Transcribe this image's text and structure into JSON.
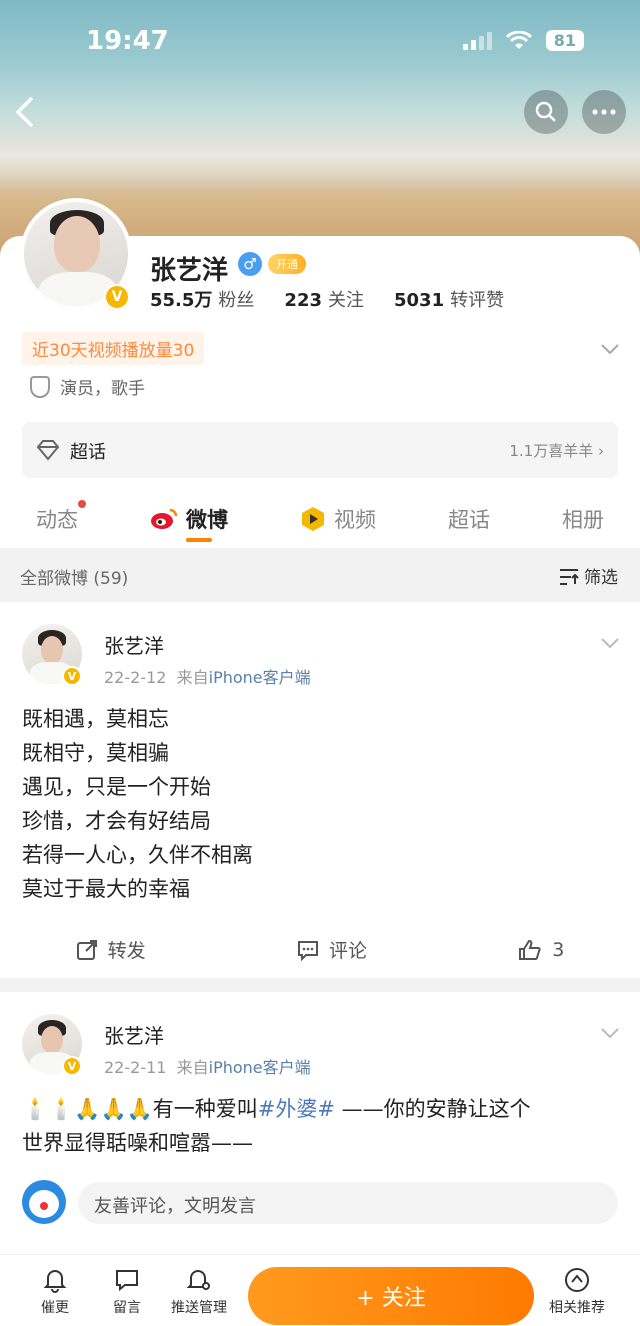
{
  "status_bar": {
    "time": "19:47",
    "battery": "81"
  },
  "profile": {
    "name": "张艺洋",
    "vip_label": "开通",
    "followers_count": "55.5万",
    "followers_label": "粉丝",
    "following_count": "223",
    "following_label": "关注",
    "engagement_count": "5031",
    "engagement_label": "转评赞",
    "video_pill": "近30天视频播放量30",
    "tagline": "演员，歌手",
    "verified_badge": "V"
  },
  "supertopic": {
    "label": "超话",
    "right_text": "1.1万喜羊羊"
  },
  "tabs": [
    {
      "label": "动态"
    },
    {
      "label": "微博"
    },
    {
      "label": "视频"
    },
    {
      "label": "超话"
    },
    {
      "label": "相册"
    }
  ],
  "filter_bar": {
    "left": "全部微博 (59)",
    "right": "筛选"
  },
  "posts": [
    {
      "name": "张艺洋",
      "date": "22-2-12",
      "source_prefix": "来自",
      "source": "iPhone客户端",
      "lines": [
        "既相遇，莫相忘",
        "既相守，莫相骗",
        "遇见，只是一个开始",
        "珍惜，才会有好结局",
        "若得一人心，久伴不相离",
        "莫过于最大的幸福"
      ],
      "repost_label": "转发",
      "comment_label": "评论",
      "like_count": "3"
    },
    {
      "name": "张艺洋",
      "date": "22-2-11",
      "source_prefix": "来自",
      "source": "iPhone客户端",
      "text_prefix": "🕯️🕯️🙏🙏🙏有一种爱叫",
      "hashtag": "#外婆#",
      "text_suffix": " ——你的安静让这个",
      "text_line2": "世界显得聒噪和喧嚣——"
    }
  ],
  "comment_box": {
    "placeholder": "友善评论，文明发言"
  },
  "bottom_bar": {
    "items": [
      "催更",
      "留言",
      "推送管理",
      "相关推荐"
    ],
    "follow_label": "+ 关注"
  },
  "colors": {
    "accent": "#ff8200",
    "link": "#4c7ab8",
    "vip": "#f5b800"
  }
}
